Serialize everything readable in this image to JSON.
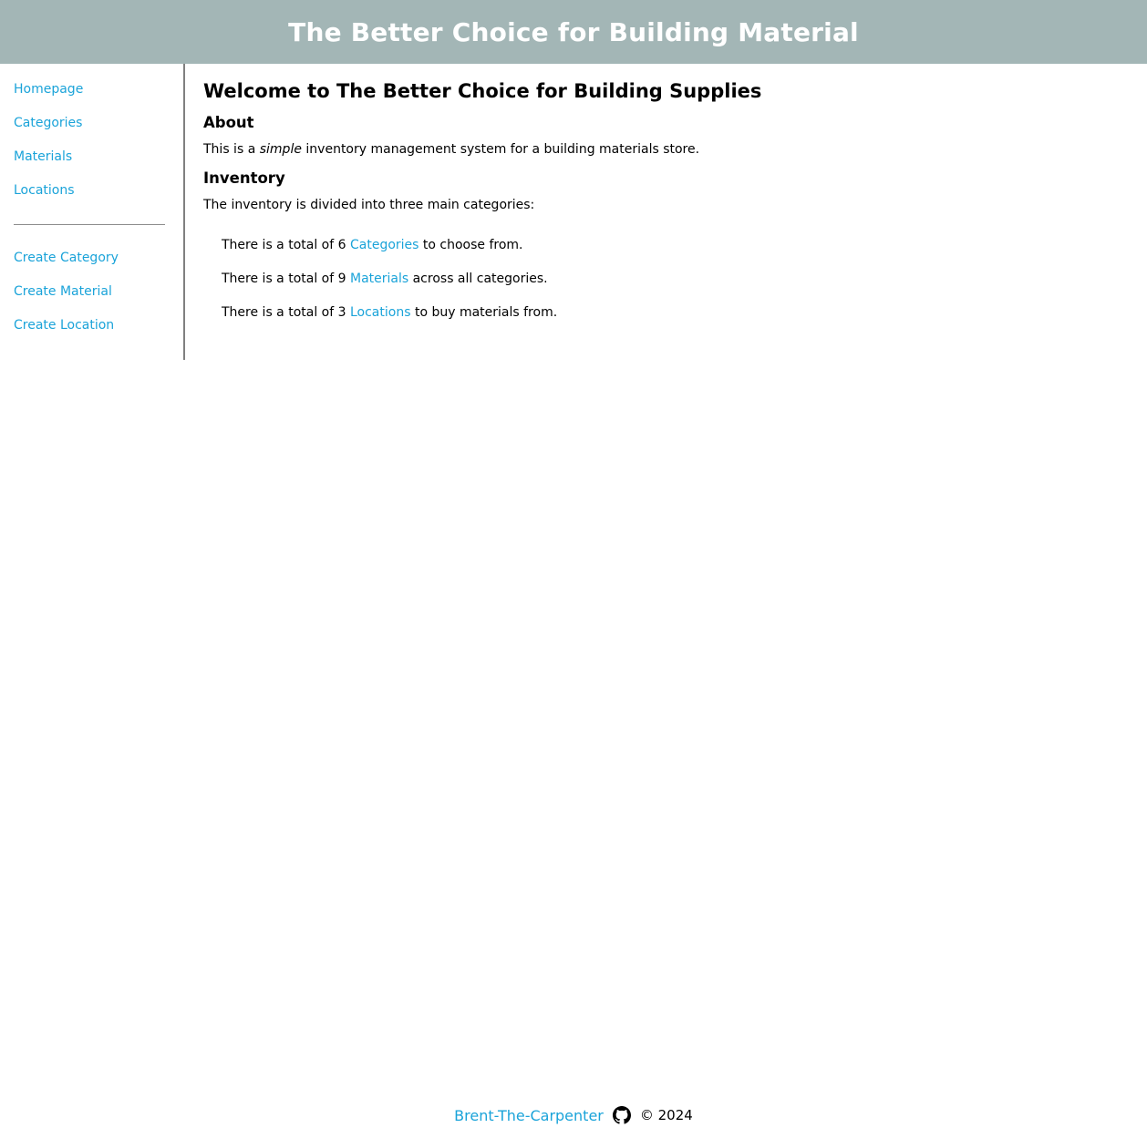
{
  "header": {
    "title": "The Better Choice for Building Material"
  },
  "sidebar": {
    "items": [
      {
        "label": "Homepage"
      },
      {
        "label": "Categories"
      },
      {
        "label": "Materials"
      },
      {
        "label": "Locations"
      }
    ],
    "create_items": [
      {
        "label": "Create Category"
      },
      {
        "label": "Create Material"
      },
      {
        "label": "Create Location"
      }
    ]
  },
  "main": {
    "title": "Welcome to The Better Choice for Building Supplies",
    "about_heading": "About",
    "about_prefix": "This is a ",
    "about_emphasis": "simple",
    "about_suffix": " inventory management system for a building materials store.",
    "inventory_heading": "Inventory",
    "inventory_intro": "The inventory is divided into three main categories:",
    "stats": [
      {
        "prefix": "There is a total of 6 ",
        "link": "Categories",
        "suffix": " to choose from."
      },
      {
        "prefix": "There is a total of 9 ",
        "link": "Materials",
        "suffix": " across all categories."
      },
      {
        "prefix": "There is a total of 3 ",
        "link": "Locations",
        "suffix": " to buy materials from."
      }
    ]
  },
  "footer": {
    "author": "Brent-The-Carpenter",
    "icon": "github-icon",
    "copyright": "© 2024"
  },
  "colors": {
    "header_bg": "#a3b6b6",
    "link": "#1aa3d9"
  }
}
